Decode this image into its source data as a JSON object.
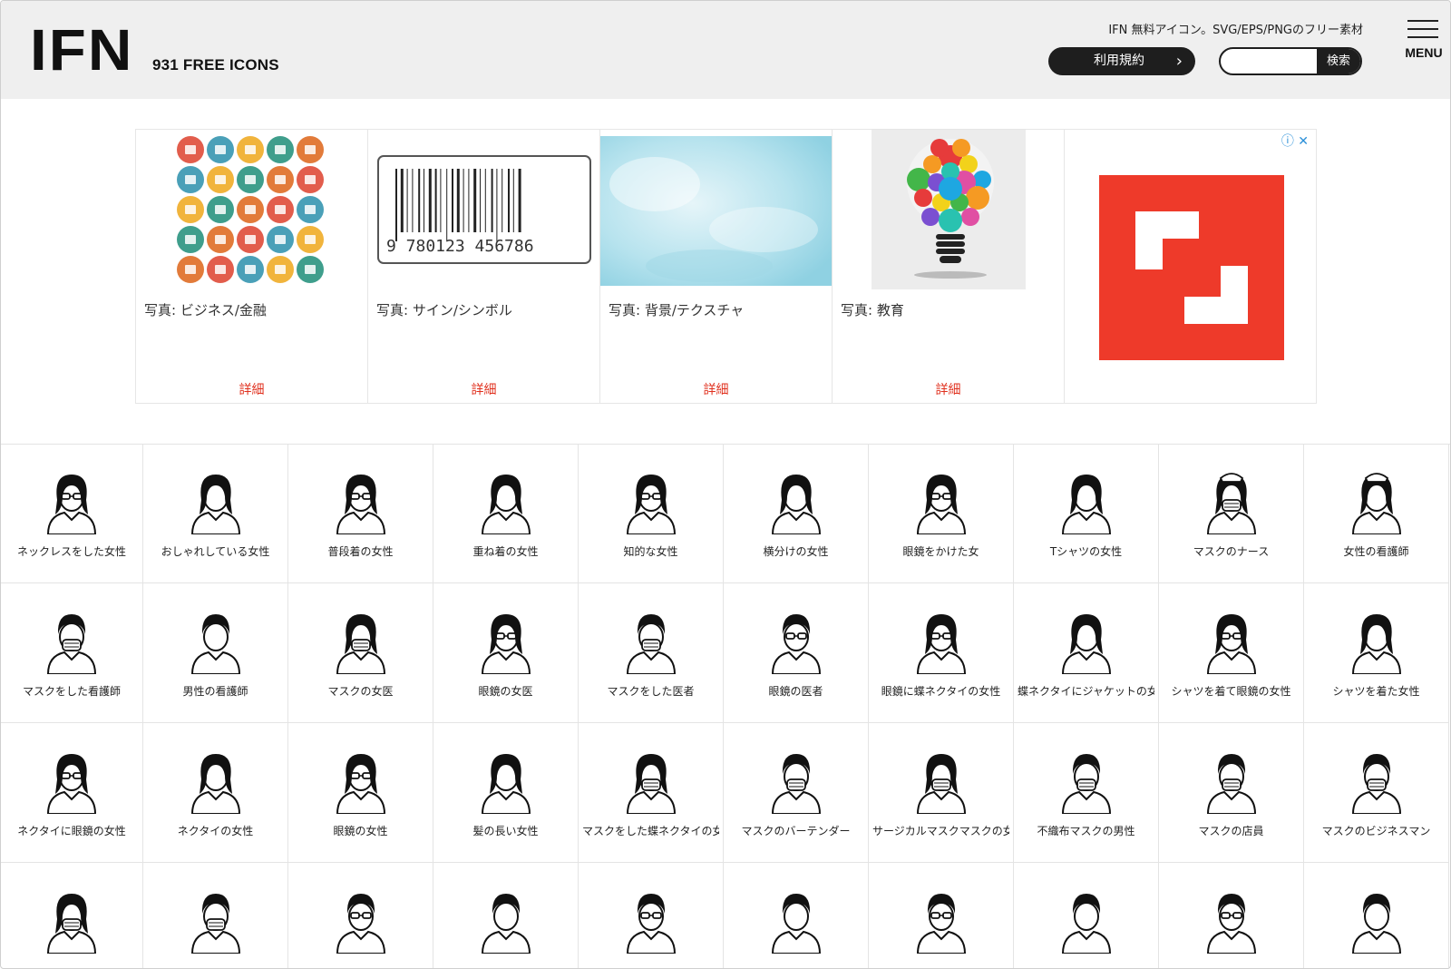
{
  "header": {
    "logo": "IFN",
    "count": "931 FREE ICONS",
    "tagline": "IFN 無料アイコン。SVG/EPS/PNGのフリー素材",
    "terms_label": "利用規約",
    "search_placeholder": "",
    "search_button": "検索",
    "menu_label": "MENU"
  },
  "ad": {
    "cards": [
      {
        "caption": "写真: ビジネス/金融",
        "more": "詳細"
      },
      {
        "caption": "写真: サイン/シンボル",
        "more": "詳細"
      },
      {
        "caption": "写真: 背景/テクスチャ",
        "more": "詳細"
      },
      {
        "caption": "写真: 教育",
        "more": "詳細"
      }
    ],
    "barcode_text": "9  780123  456786",
    "close_label": "ⓘ ✕",
    "brand_color": "#ee3a2a"
  },
  "icons": [
    {
      "label": "ネックレスをした女性",
      "icon": "woman-glasses-icon"
    },
    {
      "label": "おしゃれしている女性",
      "icon": "woman-icon"
    },
    {
      "label": "普段着の女性",
      "icon": "woman-glasses-icon"
    },
    {
      "label": "重ね着の女性",
      "icon": "woman-icon"
    },
    {
      "label": "知的な女性",
      "icon": "woman-glasses-icon"
    },
    {
      "label": "横分けの女性",
      "icon": "woman-icon"
    },
    {
      "label": "眼鏡をかけた女",
      "icon": "woman-glasses-icon"
    },
    {
      "label": "Tシャツの女性",
      "icon": "woman-icon"
    },
    {
      "label": "マスクのナース",
      "icon": "nurse-mask-icon"
    },
    {
      "label": "女性の看護師",
      "icon": "nurse-icon"
    },
    {
      "label": "マスクをした看護師",
      "icon": "man-mask-icon"
    },
    {
      "label": "男性の看護師",
      "icon": "man-icon"
    },
    {
      "label": "マスクの女医",
      "icon": "woman-mask-icon"
    },
    {
      "label": "眼鏡の女医",
      "icon": "woman-glasses-icon"
    },
    {
      "label": "マスクをした医者",
      "icon": "man-mask-icon"
    },
    {
      "label": "眼鏡の医者",
      "icon": "man-glasses-icon"
    },
    {
      "label": "眼鏡に蝶ネクタイの女性",
      "icon": "woman-glasses-icon"
    },
    {
      "label": "蝶ネクタイにジャケットの女性",
      "icon": "woman-icon"
    },
    {
      "label": "シャツを着て眼鏡の女性",
      "icon": "woman-glasses-icon"
    },
    {
      "label": "シャツを着た女性",
      "icon": "woman-icon"
    },
    {
      "label": "ネクタイに眼鏡の女性",
      "icon": "woman-glasses-icon"
    },
    {
      "label": "ネクタイの女性",
      "icon": "woman-icon"
    },
    {
      "label": "眼鏡の女性",
      "icon": "woman-glasses-icon"
    },
    {
      "label": "髪の長い女性",
      "icon": "woman-icon"
    },
    {
      "label": "マスクをした蝶ネクタイの女性",
      "icon": "woman-mask-icon"
    },
    {
      "label": "マスクのバーテンダー",
      "icon": "man-mask-icon"
    },
    {
      "label": "サージカルマスクマスクの女性",
      "icon": "woman-mask-icon"
    },
    {
      "label": "不織布マスクの男性",
      "icon": "man-mask-icon"
    },
    {
      "label": "マスクの店員",
      "icon": "man-mask-icon"
    },
    {
      "label": "マスクのビジネスマン",
      "icon": "man-mask-icon"
    },
    {
      "label": "",
      "icon": "woman-mask-icon"
    },
    {
      "label": "",
      "icon": "man-mask-icon"
    },
    {
      "label": "",
      "icon": "man-glasses-icon"
    },
    {
      "label": "",
      "icon": "man-icon"
    },
    {
      "label": "",
      "icon": "man-glasses-icon"
    },
    {
      "label": "",
      "icon": "man-icon"
    },
    {
      "label": "",
      "icon": "man-glasses-icon"
    },
    {
      "label": "",
      "icon": "man-icon"
    },
    {
      "label": "",
      "icon": "man-glasses-icon"
    },
    {
      "label": "",
      "icon": "man-icon"
    }
  ]
}
